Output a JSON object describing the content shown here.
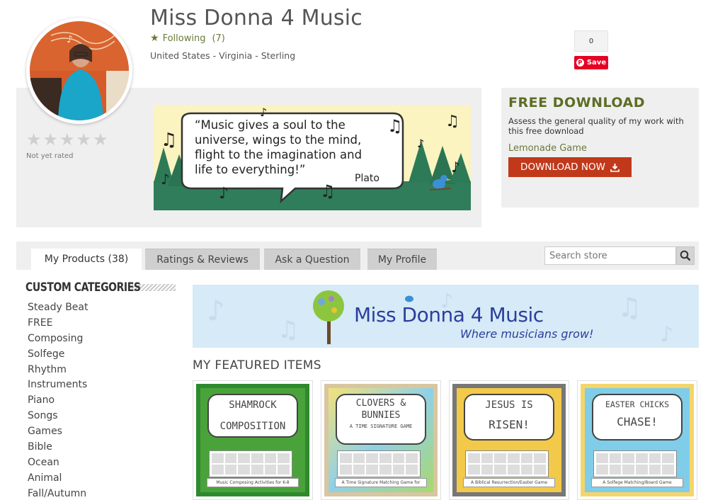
{
  "store": {
    "name": "Miss Donna 4 Music",
    "following_label": "Following",
    "following_count": "(7)",
    "location": "United States - Virginia - Sterling",
    "not_rated": "Not yet rated",
    "rating_stars": 0
  },
  "pinterest": {
    "count": "0",
    "save_label": "Save"
  },
  "quote_banner": {
    "line1": "“Music gives a soul to the",
    "line2": "universe, wings to the mind,",
    "line3": "flight to the imagination and",
    "line4": "life to everything!”",
    "author": "Plato"
  },
  "free_download": {
    "title": "FREE DOWNLOAD",
    "description": "Assess the general quality of my work with this free download",
    "product": "Lemonade Game",
    "button": "DOWNLOAD NOW"
  },
  "tabs": [
    {
      "label": "My Products (38)",
      "active": true
    },
    {
      "label": "Ratings & Reviews",
      "active": false
    },
    {
      "label": "Ask a Question",
      "active": false
    },
    {
      "label": "My Profile",
      "active": false
    }
  ],
  "search": {
    "placeholder": "Search store"
  },
  "sidebar": {
    "heading": "CUSTOM CATEGORIES",
    "categories": [
      "Steady Beat",
      "FREE",
      "Composing",
      "Solfege",
      "Rhythm",
      "Instruments",
      "Piano",
      "Songs",
      "Games",
      "Bible",
      "Ocean",
      "Animal",
      "Fall/Autumn"
    ]
  },
  "store_banner": {
    "name": "Miss Donna 4 Music",
    "tagline": "Where musicians grow!"
  },
  "featured": {
    "heading": "MY FEATURED ITEMS",
    "items": [
      {
        "title_l1": "SHAMROCK",
        "title_l2": "COMPOSITION",
        "caption": "Music Composing Activities for K-8"
      },
      {
        "title_l1": "CLOVERS &",
        "title_l2": "BUNNIES",
        "sub": "A TIME SIGNATURE GAME",
        "caption": "A Time Signature Matching Game for"
      },
      {
        "title_l1": "JESUS IS",
        "title_l2": "RISEN!",
        "caption": "A Biblical Resurrection/Easter Game"
      },
      {
        "title_l1": "EASTER CHICKS",
        "title_l2": "CHASE!",
        "caption": "A Solfege Matching/Board Game"
      }
    ]
  },
  "colors": {
    "accent_green": "#5e6d25",
    "download_red": "#c0391b",
    "pinterest_red": "#e60023"
  }
}
